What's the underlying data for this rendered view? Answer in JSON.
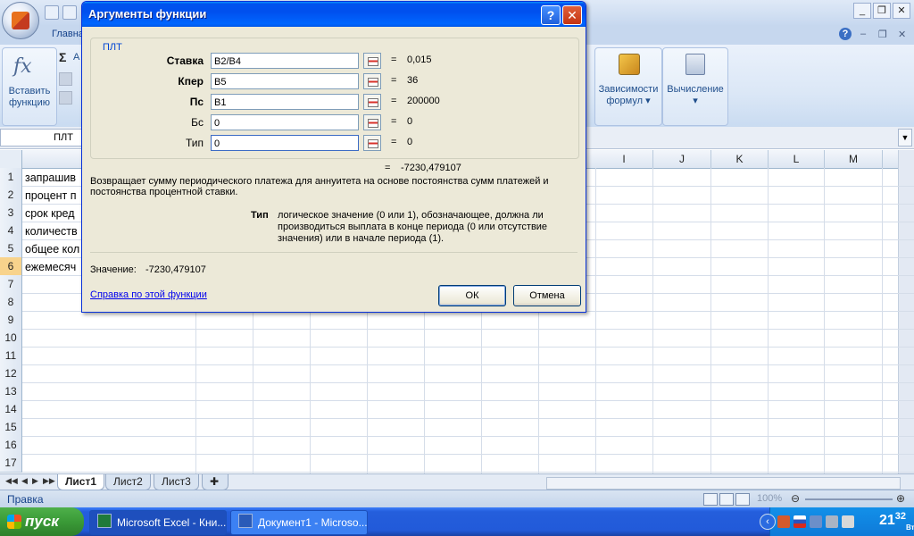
{
  "excel": {
    "tab_home": "Главна",
    "ribbon": {
      "insert_function_line1": "Вставить",
      "insert_function_line2": "функцию",
      "autosum_partial": "А",
      "dependencies_line1": "Зависимости",
      "dependencies_line2": "формул ▾",
      "calculation": "Вычисление",
      "calculation_arrow": "▾"
    },
    "name_box": "ПЛТ",
    "columns": [
      "I",
      "J",
      "K",
      "L",
      "M"
    ],
    "rows": [
      "1",
      "2",
      "3",
      "4",
      "5",
      "6",
      "7",
      "8",
      "9",
      "10",
      "11",
      "12",
      "13",
      "14",
      "15",
      "16",
      "17"
    ],
    "selected_row": "6",
    "cells_a": [
      "запрашив",
      "процент п",
      "срок кред",
      "количеств",
      "общее кол",
      "ежемесяч"
    ],
    "sheet_tabs": [
      "Лист1",
      "Лист2",
      "Лист3"
    ],
    "status": "Правка",
    "zoom": "100%"
  },
  "dialog": {
    "title": "Аргументы функции",
    "help_btn": "?",
    "close_btn": "✕",
    "function_name": "ПЛТ",
    "arguments": [
      {
        "label": "Ставка",
        "value": "B2/B4",
        "result": "0,015"
      },
      {
        "label": "Кпер",
        "value": "B5",
        "result": "36"
      },
      {
        "label": "Пс",
        "value": "B1",
        "result": "200000"
      },
      {
        "label": "Бс",
        "value": "0",
        "result": "0"
      },
      {
        "label": "Тип",
        "value": "0",
        "result": "0"
      }
    ],
    "eq": "=",
    "result": "-7230,479107",
    "description": "Возвращает сумму периодического платежа для аннуитета на основе постоянства сумм платежей и постоянства процентной ставки.",
    "arg_help_name": "Тип",
    "arg_help_desc": "логическое значение (0 или 1), обозначающее, должна ли производиться выплата в конце периода (0 или отсутствие значения) или в начале периода (1).",
    "value_label": "Значение:",
    "value": "-7230,479107",
    "help_link": "Справка по этой функции",
    "ok": "ОК",
    "cancel": "Отмена"
  },
  "taskbar": {
    "start": "пуск",
    "items": [
      "Microsoft Excel - Кни...",
      "Документ1 - Microso..."
    ],
    "clock_hour": "21",
    "clock_min": "32",
    "clock_day": "Вт"
  }
}
